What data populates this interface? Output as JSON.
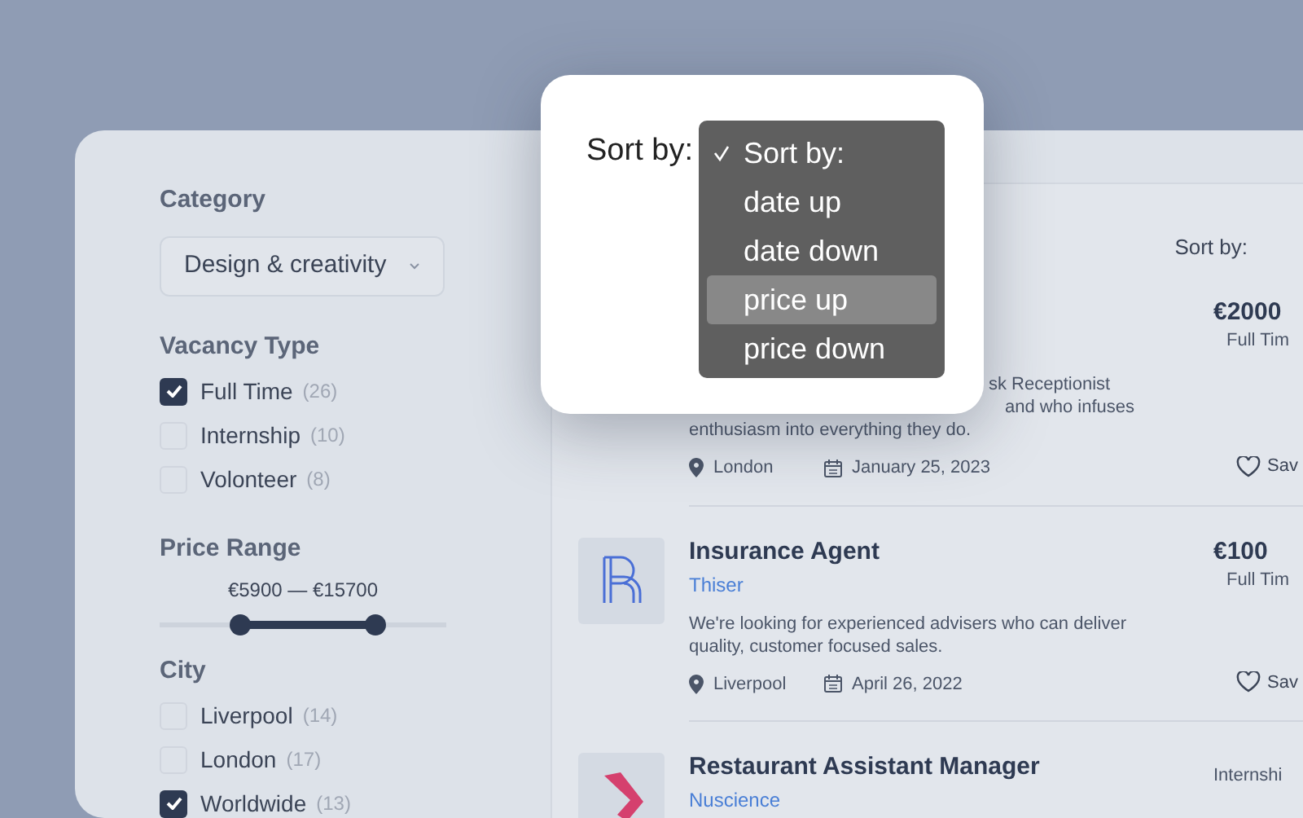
{
  "filters": {
    "category": {
      "label": "Category",
      "value": "Design & creativity"
    },
    "vacancy_type": {
      "label": "Vacancy Type",
      "options": [
        {
          "label": "Full Time",
          "count": "(26)",
          "checked": true
        },
        {
          "label": "Internship",
          "count": "(10)",
          "checked": false
        },
        {
          "label": "Volonteer",
          "count": "(8)",
          "checked": false
        }
      ]
    },
    "price_range": {
      "label": "Price Range",
      "reading": "€5900 — €15700",
      "thumbs": [
        {
          "level": 0.28
        },
        {
          "level": 0.75
        }
      ]
    },
    "city": {
      "label": "City",
      "options": [
        {
          "label": "Liverpool",
          "count": "(14)",
          "checked": false
        },
        {
          "label": "London",
          "count": "(17)",
          "checked": false
        },
        {
          "label": "Worldwide",
          "count": "(13)",
          "checked": true
        }
      ]
    }
  },
  "sort": {
    "label": "Sort by:"
  },
  "jobs": [
    {
      "description_lines": [
        "sk Receptionist",
        "and who infuses",
        "enthusiasm into everything they do."
      ],
      "location": "London",
      "date": "January 25, 2023",
      "price": "€2000",
      "type": "Full Tim",
      "save": "Sav"
    },
    {
      "kind": "lines",
      "title": "Insurance Agent",
      "company": "Thiser",
      "description": "We're looking for experienced advisers who can deliver quality, customer focused sales.",
      "location": "Liverpool",
      "date": "April 26, 2022",
      "price": "€100",
      "type": "Full Tim",
      "save": "Sav"
    },
    {
      "kind": "chevron",
      "title": "Restaurant Assistant Manager",
      "company": "Nuscience",
      "type": "Internshi"
    }
  ],
  "sort_popup": {
    "label": "Sort by:",
    "options": [
      {
        "label": "Sort by:",
        "checked": true,
        "selected": false
      },
      {
        "label": "date up",
        "checked": false,
        "selected": false
      },
      {
        "label": "date down",
        "checked": false,
        "selected": false
      },
      {
        "label": "price up",
        "checked": false,
        "selected": true
      },
      {
        "label": "price down",
        "checked": false,
        "selected": false
      }
    ]
  }
}
